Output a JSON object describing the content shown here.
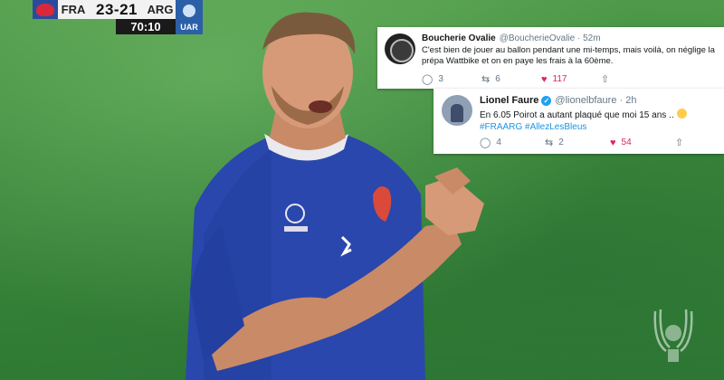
{
  "scorebug": {
    "home_team": "FRA",
    "home_score": "23",
    "separator": "-",
    "away_score": "21",
    "away_team": "ARG",
    "clock": "70:10",
    "away_logo_text": "UAR"
  },
  "tweets": [
    {
      "display_name": "Boucherie Ovalie",
      "handle": "@BoucherieOvalie",
      "time": "52m",
      "verified": false,
      "text": "C'est bien de jouer au ballon pendant une mi-temps, mais voilà, on néglige la prépa Wattbike et on en paye les frais à la 60ème.",
      "hashtags": "",
      "replies": "3",
      "retweets": "6",
      "likes": "117"
    },
    {
      "display_name": "Lionel Faure",
      "handle": "@lionelbfaure",
      "time": "2h",
      "verified": true,
      "text": "En 6.05 Poirot a autant plaqué que moi 15 ans ..",
      "hashtags": "#FRAARG #AllezLesBleus",
      "emoji_icon": "grinning-sweat-face",
      "replies": "4",
      "retweets": "2",
      "likes": "54"
    }
  ],
  "colors": {
    "pitch": "#3d8a3d",
    "france_blue": "#2342a8",
    "twitter_blue": "#1b95e0",
    "like_red": "#e0245e"
  },
  "icons": {
    "reply": "reply-icon",
    "retweet": "retweet-icon",
    "like": "heart-icon",
    "share": "share-icon"
  }
}
